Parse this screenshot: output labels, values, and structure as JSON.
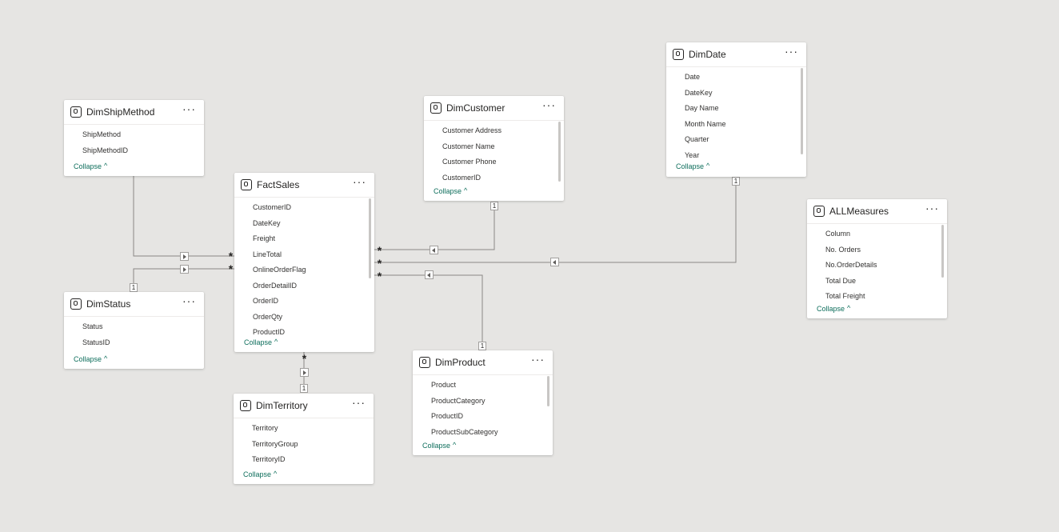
{
  "ui": {
    "collapse_label": "Collapse",
    "many_symbol": "*",
    "one_symbol": "1"
  },
  "tables": [
    {
      "name": "DimShipMethod",
      "fields": [
        "ShipMethod",
        "ShipMethodID"
      ]
    },
    {
      "name": "DimStatus",
      "fields": [
        "Status",
        "StatusID"
      ]
    },
    {
      "name": "FactSales",
      "fields": [
        "CustomerID",
        "DateKey",
        "Freight",
        "LineTotal",
        "OnlineOrderFlag",
        "OrderDetailID",
        "OrderID",
        "OrderQty",
        "ProductID"
      ]
    },
    {
      "name": "DimCustomer",
      "fields": [
        "Customer Address",
        "Customer Name",
        "Customer Phone",
        "CustomerID"
      ]
    },
    {
      "name": "DimDate",
      "fields": [
        "Date",
        "DateKey",
        "Day Name",
        "Month Name",
        "Quarter",
        "Year"
      ]
    },
    {
      "name": "ALLMeasures",
      "fields": [
        "Column",
        "No. Orders",
        "No.OrderDetails",
        "Total Due",
        "Total Freight"
      ]
    },
    {
      "name": "DimProduct",
      "fields": [
        "Product",
        "ProductCategory",
        "ProductID",
        "ProductSubCategory"
      ]
    },
    {
      "name": "DimTerritory",
      "fields": [
        "Territory",
        "TerritoryGroup",
        "TerritoryID"
      ]
    }
  ],
  "relationships": [
    {
      "from": "DimShipMethod",
      "to": "FactSales",
      "from_cardinality": "1",
      "to_cardinality": "*"
    },
    {
      "from": "DimStatus",
      "to": "FactSales",
      "from_cardinality": "1",
      "to_cardinality": "*"
    },
    {
      "from": "DimCustomer",
      "to": "FactSales",
      "from_cardinality": "1",
      "to_cardinality": "*"
    },
    {
      "from": "DimDate",
      "to": "FactSales",
      "from_cardinality": "1",
      "to_cardinality": "*"
    },
    {
      "from": "DimProduct",
      "to": "FactSales",
      "from_cardinality": "1",
      "to_cardinality": "*"
    },
    {
      "from": "DimTerritory",
      "to": "FactSales",
      "from_cardinality": "1",
      "to_cardinality": "*"
    }
  ]
}
